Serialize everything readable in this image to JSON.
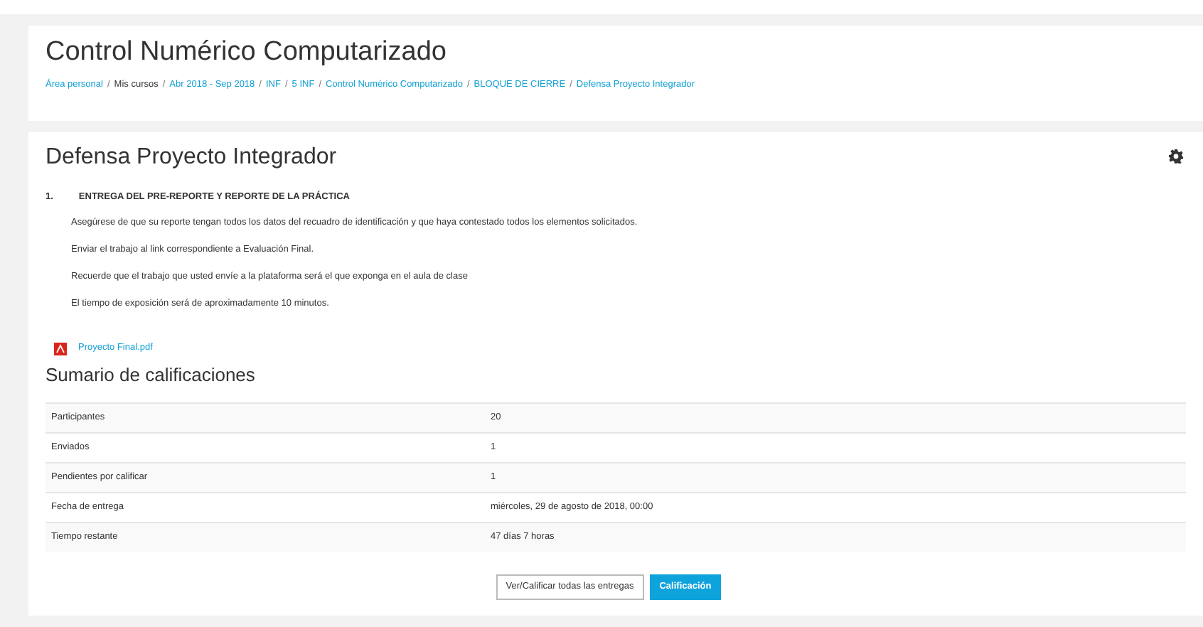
{
  "header": {
    "title": "Control Numérico Computarizado",
    "breadcrumb": [
      {
        "label": "Área personal",
        "link": true
      },
      {
        "separator": "/",
        "label": "Mis cursos",
        "link": false
      },
      {
        "separator": "/",
        "label": "Abr 2018 - Sep 2018",
        "link": true
      },
      {
        "separator": "/",
        "label": "INF",
        "link": true
      },
      {
        "separator": "/",
        "label": "5 INF",
        "link": true
      },
      {
        "separator": "/",
        "label": "Control Numérico Computarizado",
        "link": true
      },
      {
        "separator": "/",
        "label": "BLOQUE DE CIERRE",
        "link": true
      },
      {
        "separator": "/",
        "label": "Defensa Proyecto Integrador",
        "link": true
      }
    ]
  },
  "activity": {
    "title": "Defensa Proyecto Integrador",
    "section_number": "1.",
    "section_title": "ENTREGA DEL PRE-REPORTE Y REPORTE DE LA PRÁCTICA",
    "paragraphs": [
      "Asegúrese de que su reporte tengan todos los datos del recuadro de identificación y que haya contestado todos los elementos solicitados.",
      "Enviar el trabajo al link correspondiente a Evaluación Final.",
      "Recuerde que el trabajo que usted envíe a la plataforma será el que exponga en el aula de clase",
      "El tiempo de exposición será de aproximadamente 10 minutos."
    ],
    "file": "Proyecto Final.pdf",
    "summary_title": "Sumario de calificaciones",
    "summary": [
      {
        "label": "Participantes",
        "value": "20"
      },
      {
        "label": "Enviados",
        "value": "1"
      },
      {
        "label": "Pendientes por calificar",
        "value": "1"
      },
      {
        "label": "Fecha de entrega",
        "value": "miércoles, 29 de agosto de 2018, 00:00"
      },
      {
        "label": "Tiempo restante",
        "value": "47 días 7 horas"
      }
    ],
    "buttons": [
      {
        "label": "Ver/Calificar todas las entregas",
        "kind": "secondary"
      },
      {
        "label": "Calificación",
        "kind": "primary"
      }
    ]
  }
}
